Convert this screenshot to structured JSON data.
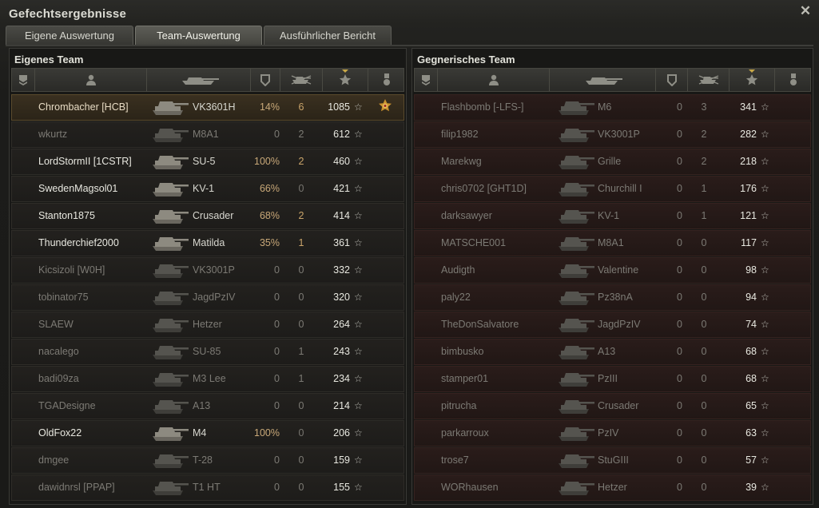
{
  "window": {
    "title": "Gefechtsergebnisse",
    "close_icon": "close-icon"
  },
  "tabs": [
    {
      "label": "Eigene Auswertung",
      "active": false
    },
    {
      "label": "Team-Auswertung",
      "active": true
    },
    {
      "label": "Ausführlicher Bericht",
      "active": false
    }
  ],
  "own_team": {
    "title": "Eigenes Team",
    "columns": [
      "squad-icon",
      "player-icon",
      "tank-icon",
      "shield-icon",
      "kills-icon",
      "star-icon",
      "medal-icon"
    ],
    "rows": [
      {
        "player": "Chrombacher [HCB]",
        "tank": "VK3601H",
        "accuracy": "14%",
        "frags": "6",
        "xp": "1085",
        "alive": true,
        "self": true,
        "medal": true
      },
      {
        "player": "wkurtz",
        "tank": "M8A1",
        "accuracy": "0",
        "frags": "2",
        "xp": "612",
        "alive": false
      },
      {
        "player": "LordStormII [1CSTR]",
        "tank": "SU-5",
        "accuracy": "100%",
        "frags": "2",
        "xp": "460",
        "alive": true
      },
      {
        "player": "SwedenMagsol01",
        "tank": "KV-1",
        "accuracy": "66%",
        "frags": "0",
        "xp": "421",
        "alive": true
      },
      {
        "player": "Stanton1875",
        "tank": "Crusader",
        "accuracy": "68%",
        "frags": "2",
        "xp": "414",
        "alive": true
      },
      {
        "player": "Thunderchief2000",
        "tank": "Matilda",
        "accuracy": "35%",
        "frags": "1",
        "xp": "361",
        "alive": true
      },
      {
        "player": "Kicsizoli [W0H]",
        "tank": "VK3001P",
        "accuracy": "0",
        "frags": "0",
        "xp": "332",
        "alive": false
      },
      {
        "player": "tobinator75",
        "tank": "JagdPzIV",
        "accuracy": "0",
        "frags": "0",
        "xp": "320",
        "alive": false
      },
      {
        "player": "SLAEW",
        "tank": "Hetzer",
        "accuracy": "0",
        "frags": "0",
        "xp": "264",
        "alive": false
      },
      {
        "player": "nacalego",
        "tank": "SU-85",
        "accuracy": "0",
        "frags": "1",
        "xp": "243",
        "alive": false
      },
      {
        "player": "badi09za",
        "tank": "M3 Lee",
        "accuracy": "0",
        "frags": "1",
        "xp": "234",
        "alive": false
      },
      {
        "player": "TGADesigne",
        "tank": "A13",
        "accuracy": "0",
        "frags": "0",
        "xp": "214",
        "alive": false
      },
      {
        "player": "OldFox22",
        "tank": "M4",
        "accuracy": "100%",
        "frags": "0",
        "xp": "206",
        "alive": true
      },
      {
        "player": "dmgee",
        "tank": "T-28",
        "accuracy": "0",
        "frags": "0",
        "xp": "159",
        "alive": false
      },
      {
        "player": "dawidnrsl [PPAP]",
        "tank": "T1 HT",
        "accuracy": "0",
        "frags": "0",
        "xp": "155",
        "alive": false
      }
    ]
  },
  "enemy_team": {
    "title": "Gegnerisches Team",
    "rows": [
      {
        "player": "Flashbomb [-LFS-]",
        "tank": "M6",
        "accuracy": "0",
        "frags": "3",
        "xp": "341"
      },
      {
        "player": "filip1982",
        "tank": "VK3001P",
        "accuracy": "0",
        "frags": "2",
        "xp": "282"
      },
      {
        "player": "Marekwg",
        "tank": "Grille",
        "accuracy": "0",
        "frags": "2",
        "xp": "218"
      },
      {
        "player": "chris0702 [GHT1D]",
        "tank": "Churchill I",
        "accuracy": "0",
        "frags": "1",
        "xp": "176"
      },
      {
        "player": "darksawyer",
        "tank": "KV-1",
        "accuracy": "0",
        "frags": "1",
        "xp": "121"
      },
      {
        "player": "MATSCHE001",
        "tank": "M8A1",
        "accuracy": "0",
        "frags": "0",
        "xp": "117"
      },
      {
        "player": "Audigth",
        "tank": "Valentine",
        "accuracy": "0",
        "frags": "0",
        "xp": "98"
      },
      {
        "player": "paly22",
        "tank": "Pz38nA",
        "accuracy": "0",
        "frags": "0",
        "xp": "94"
      },
      {
        "player": "TheDonSalvatore",
        "tank": "JagdPzIV",
        "accuracy": "0",
        "frags": "0",
        "xp": "74"
      },
      {
        "player": "bimbusko",
        "tank": "A13",
        "accuracy": "0",
        "frags": "0",
        "xp": "68"
      },
      {
        "player": "stamper01",
        "tank": "PzIII",
        "accuracy": "0",
        "frags": "0",
        "xp": "68"
      },
      {
        "player": "pitrucha",
        "tank": "Crusader",
        "accuracy": "0",
        "frags": "0",
        "xp": "65"
      },
      {
        "player": "parkarroux",
        "tank": "PzIV",
        "accuracy": "0",
        "frags": "0",
        "xp": "63"
      },
      {
        "player": "trose7",
        "tank": "StuGIII",
        "accuracy": "0",
        "frags": "0",
        "xp": "57"
      },
      {
        "player": "WORhausen",
        "tank": "Hetzer",
        "accuracy": "0",
        "frags": "0",
        "xp": "39"
      }
    ]
  },
  "colors": {
    "accent_gold": "#c8a848",
    "alive_text": "#e8e8e0",
    "dead_text": "#7c7a74",
    "enemy_row": "#2a1c1a"
  }
}
